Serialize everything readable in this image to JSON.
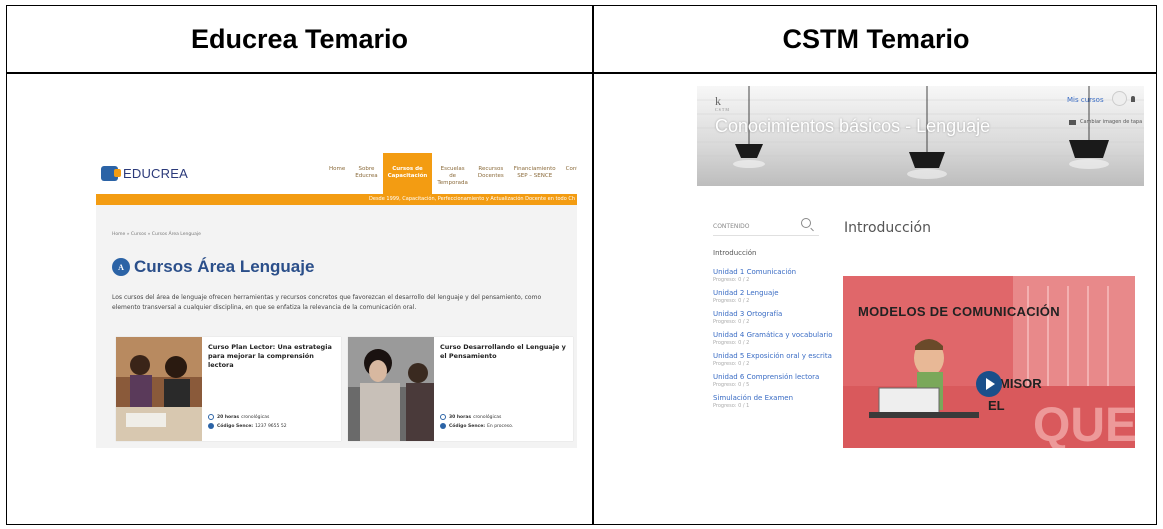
{
  "headers": {
    "left": "Educrea Temario",
    "right": "CSTM Temario"
  },
  "educrea": {
    "logo_text": "EDUCREA",
    "menu": [
      {
        "label": "Home"
      },
      {
        "label": "Sobre\nEducrea"
      },
      {
        "label": "Cursos de\nCapacitación",
        "active": true
      },
      {
        "label": "Escuelas de\nTemporada"
      },
      {
        "label": "Recursos\nDocentes"
      },
      {
        "label": "Financiamiento\nSEP – SENCE"
      },
      {
        "label": "Contac"
      }
    ],
    "bar_text": "Desde 1999, Capacitación, Perfeccionamiento y Actualización Docente en todo Ch",
    "breadcrumb": "Home » Cursos » Cursos Área Lenguaje",
    "title_icon": "A",
    "title": "Cursos Área Lenguaje",
    "description": "Los cursos del área de lenguaje ofrecen herramientas y recursos concretos que favorezcan el desarrollo del lenguaje y del pensamiento, como elemento transversal a cualquier disciplina, en que se enfatiza la relevancia de la comunicación oral.",
    "cards": [
      {
        "title": "Curso Plan Lector: Una estrategia para mejorar la comprensión lectora",
        "hours_bold": "20 horas",
        "hours_rest": "cronológicas",
        "code_label": "Código Sence:",
        "code_value": "1237 9655 52"
      },
      {
        "title": "Curso Desarrollando el Lenguaje y el Pensamiento",
        "hours_bold": "30 horas",
        "hours_rest": "cronológicas",
        "code_label": "Código Sence:",
        "code_value": "En proceso."
      }
    ],
    "colors": {
      "accent": "#f39c12",
      "brand": "#2b63a6"
    }
  },
  "cstm": {
    "logo": "k",
    "logo_sub": "CSTM",
    "mis_cursos": "Mis cursos",
    "cambiar": "Cambiar imagen de tapa",
    "hero_title": "Conocimientos básicos - Lenguaje",
    "sidebar_header": "CONTENIDO",
    "intro_link": "Introducción",
    "units": [
      {
        "name": "Unidad 1 Comunicación",
        "progress": "Progreso: 0 / 2"
      },
      {
        "name": "Unidad 2 Lenguaje",
        "progress": "Progreso: 0 / 2"
      },
      {
        "name": "Unidad 3 Ortografía",
        "progress": "Progreso: 0 / 2"
      },
      {
        "name": "Unidad 4 Gramática y vocabulario",
        "progress": "Progreso: 0 / 2"
      },
      {
        "name": "Unidad 5 Exposición oral y escrita",
        "progress": "Progreso: 0 / 2"
      },
      {
        "name": "Unidad 6 Comprensión lectora",
        "progress": "Progreso: 0 / 5"
      },
      {
        "name": "Simulación de Examen",
        "progress": "Progreso: 0 / 1"
      }
    ],
    "main_title": "Introducción",
    "video_title": "MODELOS DE COMUNICACIÓN",
    "video_emisor": "MISOR",
    "video_el": "EL",
    "video_big": "QUE",
    "colors": {
      "link": "#3a6cc4",
      "video_bg": "#e0676a"
    }
  }
}
